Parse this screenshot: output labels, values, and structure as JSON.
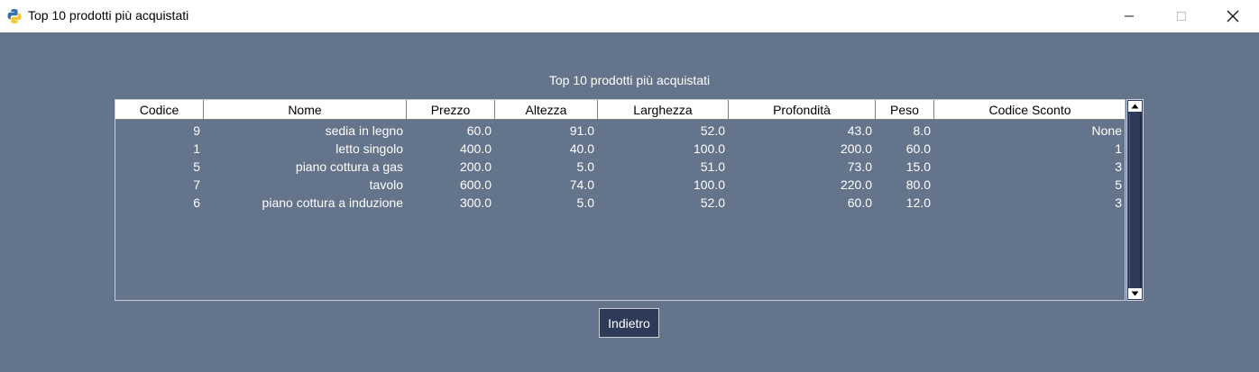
{
  "window": {
    "title": "Top 10 prodotti più acquistati",
    "icon": "python-icon"
  },
  "table": {
    "caption": "Top 10 prodotti più acquistati",
    "columns": [
      "Codice",
      "Nome",
      "Prezzo",
      "Altezza",
      "Larghezza",
      "Profondità",
      "Peso",
      "Codice Sconto"
    ],
    "rows": [
      [
        "9",
        "sedia in legno",
        "60.0",
        "91.0",
        "52.0",
        "43.0",
        "8.0",
        "None"
      ],
      [
        "1",
        "letto singolo",
        "400.0",
        "40.0",
        "100.0",
        "200.0",
        "60.0",
        "1"
      ],
      [
        "5",
        "piano cottura a gas",
        "200.0",
        "5.0",
        "51.0",
        "73.0",
        "15.0",
        "3"
      ],
      [
        "7",
        "tavolo",
        "600.0",
        "74.0",
        "100.0",
        "220.0",
        "80.0",
        "5"
      ],
      [
        "6",
        "piano cottura a induzione",
        "300.0",
        "5.0",
        "52.0",
        "60.0",
        "12.0",
        "3"
      ]
    ]
  },
  "buttons": {
    "back_label": "Indietro"
  },
  "colors": {
    "background": "#64748b",
    "dark_accent": "#2d3a58",
    "text_light": "#ffffff"
  }
}
